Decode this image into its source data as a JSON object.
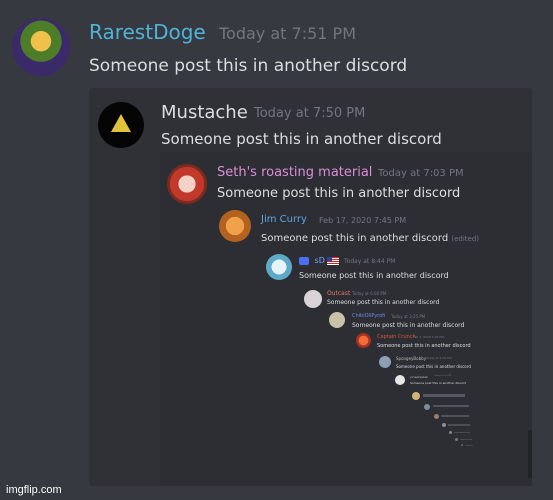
{
  "messages": [
    {
      "author": "RarestDoge",
      "time": "Today at 7:51 PM",
      "text": "Someone post this in another discord",
      "name_color": "#4fb3d9"
    },
    {
      "author": "Mustache",
      "time": "Today at 7:50 PM",
      "text": "Someone post this in another discord",
      "name_color": "#dcddde"
    },
    {
      "author": "Seth's roasting material",
      "time": "Today at 7:03 PM",
      "text": "Someone post this in another discord",
      "name_color": "#d98fd6"
    },
    {
      "author": "Jim Curry",
      "time": "Feb 17, 2020 7:45 PM",
      "text": "Someone post this in another discord",
      "edited": "(edited)",
      "name_color": "#5aa7e6"
    },
    {
      "author": "sD",
      "time": "Today at 8:44 PM",
      "text": "Someone post this in another discord",
      "name_color": "#7aa0ff"
    },
    {
      "author": "Outcast",
      "time": "Today at 6:00 PM",
      "text": "Someone post this in another discord",
      "name_color": "#e07a5f"
    },
    {
      "author": "ChibiOliPyroh",
      "time": "Today at 3:25 PM",
      "text": "Someone post this in another discord",
      "name_color": "#6c8ee8"
    },
    {
      "author": "Captain Crunch",
      "time": "Feb 7, 2020 5:26 PM",
      "text": "Someone post this in another discord",
      "name_color": "#e0533d"
    },
    {
      "author": "SpongeyBobby",
      "time": "Today at 4:00 PM",
      "text": "Someone post this in another discord",
      "name_color": "#bbbbbb"
    },
    {
      "author": "joneskasket",
      "time": "Today at 1:00 PM",
      "text": "Someone post this in another discord",
      "name_color": "#bbbbbb"
    }
  ],
  "watermark": "imgflip.com",
  "colors": {
    "background": "#36393f",
    "embed": "#2f3136",
    "text": "#dcddde",
    "timestamp": "#72767d"
  }
}
